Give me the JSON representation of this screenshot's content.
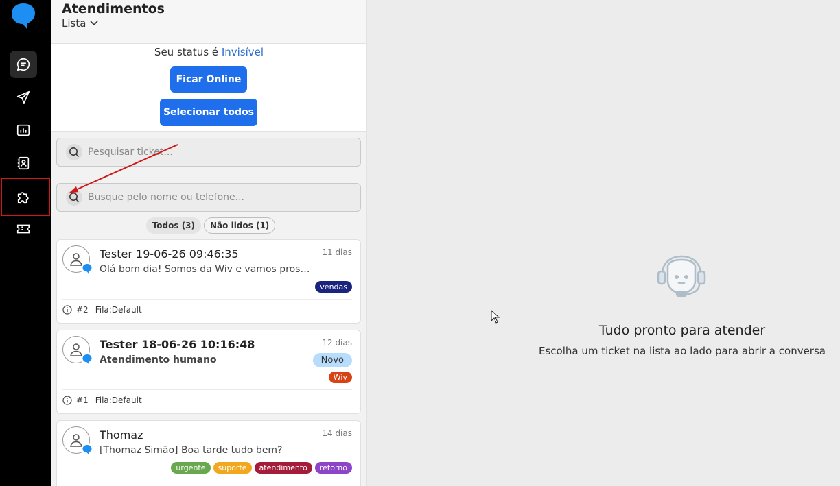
{
  "header": {
    "title": "Atendimentos",
    "view": "Lista"
  },
  "status": {
    "prefix": "Seu status é",
    "value": "Invisível"
  },
  "buttons": {
    "go_online": "Ficar Online",
    "select_all": "Selecionar todos"
  },
  "search": {
    "ticket_placeholder": "Pesquisar ticket...",
    "contact_placeholder": "Busque pelo nome ou telefone..."
  },
  "filters": [
    {
      "label": "Todos (3)",
      "active": true
    },
    {
      "label": "Não lidos (1)",
      "active": false
    }
  ],
  "sidebar": {
    "items": [
      {
        "name": "chat-icon",
        "active": true
      },
      {
        "name": "send-icon",
        "active": false
      },
      {
        "name": "chart-icon",
        "active": false
      },
      {
        "name": "contacts-icon",
        "active": false
      },
      {
        "name": "puzzle-icon",
        "active": false,
        "highlighted": true
      },
      {
        "name": "ticket-icon",
        "active": false
      }
    ]
  },
  "tickets": [
    {
      "name": "Tester 19-06-26 09:46:35",
      "time": "11 dias",
      "message": "Olá bom dia! Somos da Wiv e vamos prosseguir com seu ...",
      "tags": [
        {
          "label": "vendas",
          "color": "#1a237e"
        }
      ],
      "number": "#2",
      "queue": "Fila:Default"
    },
    {
      "name": "Tester 18-06-26 10:16:48",
      "time": "12 dias",
      "message": "Atendimento humano",
      "badge": "Novo",
      "tags": [
        {
          "label": "Wiv",
          "color": "#d84315"
        }
      ],
      "number": "#1",
      "queue": "Fila:Default"
    },
    {
      "name": "Thomaz",
      "time": "14 dias",
      "message": "[Thomaz Simão] Boa tarde tudo bem?",
      "tags": [
        {
          "label": "urgente",
          "color": "#6aa84f"
        },
        {
          "label": "suporte",
          "color": "#f1a81f"
        },
        {
          "label": "atendimento",
          "color": "#a51b3a"
        },
        {
          "label": "retorno",
          "color": "#8e44c9"
        }
      ]
    }
  ],
  "empty_state": {
    "title": "Tudo pronto para atender",
    "subtitle": "Escolha um ticket na lista ao lado para abrir a conversa"
  },
  "colors": {
    "accent": "#1f6fec",
    "sidebar": "#000000",
    "annotation": "#d01818"
  }
}
